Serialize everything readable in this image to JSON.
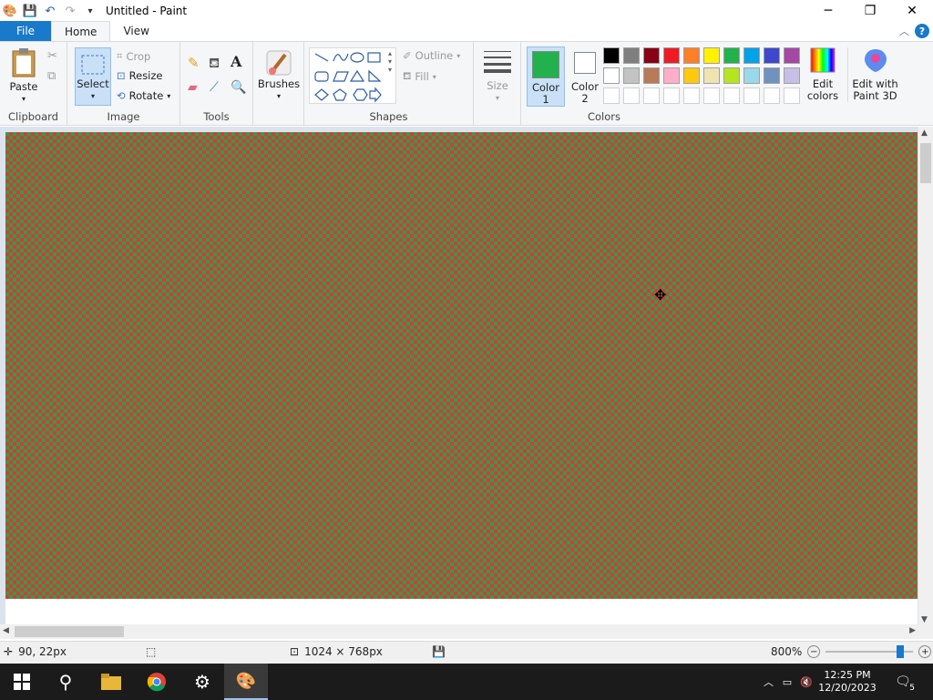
{
  "window": {
    "title": "Untitled - Paint",
    "minimize_icon": "minimize-icon",
    "maximize_icon": "maximize-icon",
    "close_icon": "close-icon"
  },
  "menu": {
    "file": "File",
    "tabs": [
      "Home",
      "View"
    ],
    "active_tab": "Home"
  },
  "ribbon": {
    "clipboard": {
      "label": "Clipboard",
      "paste": "Paste"
    },
    "image": {
      "label": "Image",
      "select": "Select",
      "crop": "Crop",
      "resize": "Resize",
      "rotate": "Rotate"
    },
    "tools": {
      "label": "Tools"
    },
    "brushes": {
      "label": "Brushes"
    },
    "shapes": {
      "label": "Shapes",
      "outline": "Outline",
      "fill": "Fill"
    },
    "size": {
      "label": "Size"
    },
    "colors": {
      "label": "Colors",
      "color1": "Color",
      "color1_num": "1",
      "color2": "Color",
      "color2_num": "2",
      "color1_value": "#22b14c",
      "color2_value": "#ffffff",
      "edit_colors": "Edit",
      "edit_colors_2": "colors",
      "edit_3d": "Edit with",
      "edit_3d_2": "Paint 3D",
      "palette_row1": [
        "#000000",
        "#7f7f7f",
        "#880015",
        "#ed1c24",
        "#ff7f27",
        "#fff200",
        "#22b14c",
        "#00a2e8",
        "#3f48cc",
        "#a349a4"
      ],
      "palette_row2": [
        "#ffffff",
        "#c3c3c3",
        "#b97a57",
        "#ffaec9",
        "#ffc90e",
        "#efe4b0",
        "#b5e61d",
        "#99d9ea",
        "#7092be",
        "#c8bfe7"
      ]
    }
  },
  "canvas": {
    "pattern_colors": [
      "#d8383e",
      "#2ea043"
    ]
  },
  "status": {
    "cursor_pos": "90, 22px",
    "image_size": "1024 × 768px",
    "zoom": "800%"
  },
  "taskbar": {
    "time": "12:25 PM",
    "date": "12/20/2023",
    "notifications": "5"
  }
}
